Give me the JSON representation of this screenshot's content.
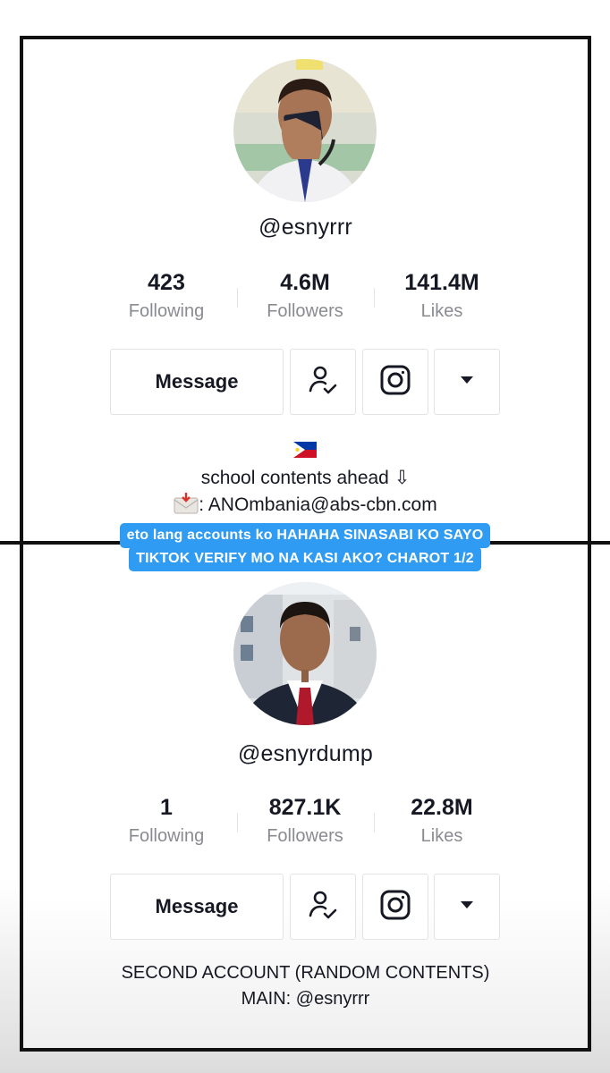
{
  "accounts": [
    {
      "username": "@esnyrrr",
      "stats": [
        {
          "value": "423",
          "label": "Following"
        },
        {
          "value": "4.6M",
          "label": "Followers"
        },
        {
          "value": "141.4M",
          "label": "Likes"
        }
      ],
      "message_label": "Message",
      "bio": {
        "flag": "philippines-flag",
        "line1": "school contents ahead ⇩",
        "line2_icon": "envelope-icon",
        "line2": ": ANOmbania@abs-cbn.com"
      }
    },
    {
      "username": "@esnyrdump",
      "stats": [
        {
          "value": "1",
          "label": "Following"
        },
        {
          "value": "827.1K",
          "label": "Followers"
        },
        {
          "value": "22.8M",
          "label": "Likes"
        }
      ],
      "message_label": "Message",
      "bio": {
        "line1": "SECOND ACCOUNT (RANDOM CONTENTS)",
        "line2": "MAIN: @esnyrrr"
      }
    }
  ],
  "caption": {
    "line1": "eto lang accounts ko HAHAHA SINASABI KO SAYO",
    "line2": "TIKTOK VERIFY MO NA KASI AKO? CHAROT 1/2"
  },
  "colors": {
    "caption_bg": "#2f9bf2",
    "text_primary": "#161823",
    "text_secondary": "#8a8b91",
    "frame": "#111111"
  }
}
